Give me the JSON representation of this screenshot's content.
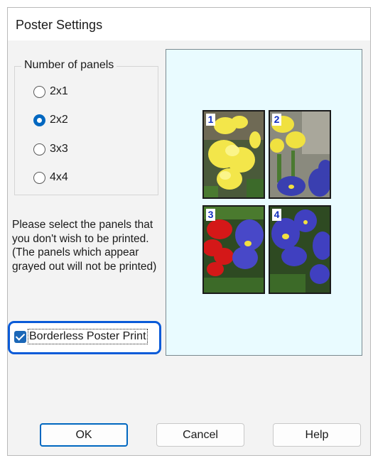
{
  "dialog": {
    "title": "Poster Settings"
  },
  "panels_group": {
    "legend": "Number of panels",
    "options": [
      {
        "label": "2x1",
        "checked": false
      },
      {
        "label": "2x2",
        "checked": true
      },
      {
        "label": "3x3",
        "checked": false
      },
      {
        "label": "4x4",
        "checked": false
      }
    ]
  },
  "instructions": "Please select the panels that you don't wish to be printed. (The panels which appear grayed out will not be printed)",
  "borderless": {
    "label": "Borderless Poster Print",
    "checked": true
  },
  "preview": {
    "panel_numbers": [
      "1",
      "2",
      "3",
      "4"
    ]
  },
  "buttons": {
    "ok": "OK",
    "cancel": "Cancel",
    "help": "Help"
  },
  "colors": {
    "accent": "#0067c0",
    "focus": "#0a5bd8",
    "preview_bg": "#e9fbff"
  }
}
